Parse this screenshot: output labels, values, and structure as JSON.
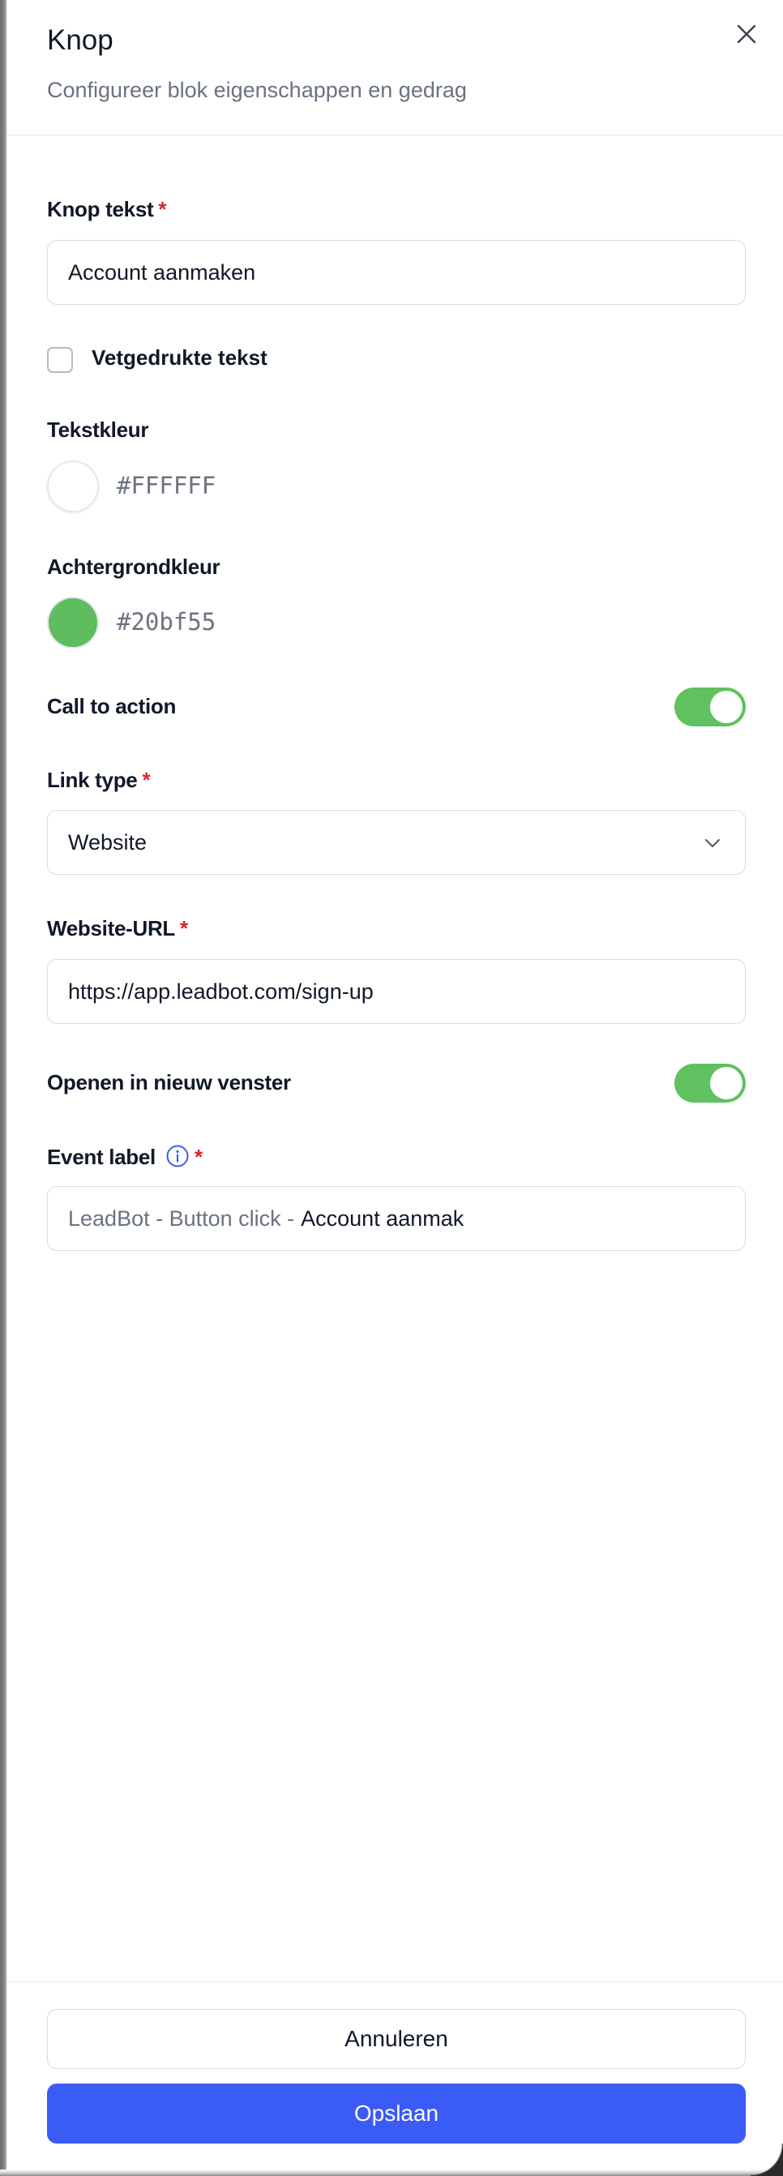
{
  "header": {
    "title": "Knop",
    "subtitle": "Configureer blok eigenschappen en gedrag",
    "close_icon": "close-icon"
  },
  "form": {
    "button_text": {
      "label": "Knop tekst",
      "required_mark": "*",
      "value": "Account aanmaken"
    },
    "bold_text": {
      "label": "Vetgedrukte tekst",
      "checked": false
    },
    "text_color": {
      "label": "Tekstkleur",
      "hex": "#FFFFFF",
      "swatch_color": "#ffffff"
    },
    "background_color": {
      "label": "Achtergrondkleur",
      "hex": "#20bf55",
      "swatch_color": "#5fbc5f"
    },
    "call_to_action": {
      "label": "Call to action",
      "enabled": true
    },
    "link_type": {
      "label": "Link type",
      "required_mark": "*",
      "value": "Website",
      "icon": "chevron-down-icon"
    },
    "website_url": {
      "label": "Website-URL",
      "required_mark": "*",
      "value": "https://app.leadbot.com/sign-up"
    },
    "open_new_window": {
      "label": "Openen in nieuw venster",
      "enabled": true
    },
    "event_label": {
      "label": "Event label",
      "required_mark": "*",
      "prefix": "LeadBot - Button click -",
      "value": "Account aanmak",
      "icon": "info-icon"
    }
  },
  "footer": {
    "cancel_label": "Annuleren",
    "save_label": "Opslaan"
  },
  "colors": {
    "accent": "#3b5bf6",
    "toggle_on": "#5fc15f",
    "required": "#dc2626"
  }
}
